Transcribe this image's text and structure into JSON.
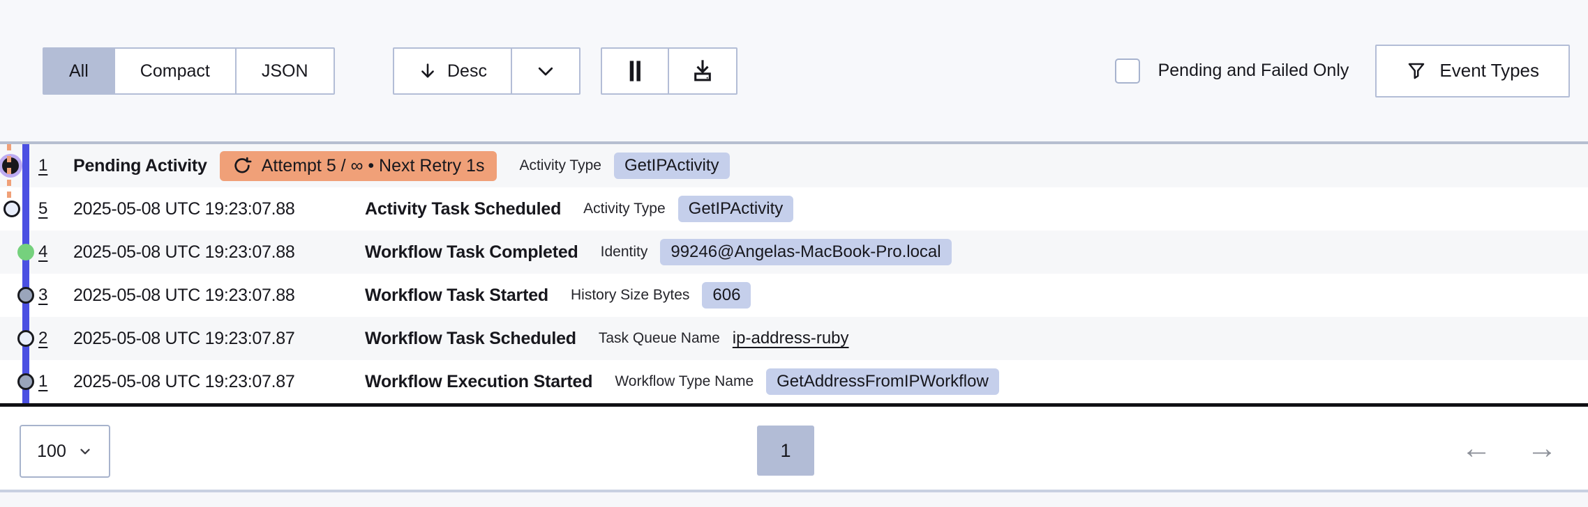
{
  "toolbar": {
    "view_modes": [
      {
        "key": "all",
        "label": "All",
        "selected": true
      },
      {
        "key": "compact",
        "label": "Compact",
        "selected": false
      },
      {
        "key": "json",
        "label": "JSON",
        "selected": false
      }
    ],
    "sort": {
      "label": "Desc"
    },
    "filter_checkbox": {
      "label": "Pending and Failed Only",
      "checked": false
    },
    "event_types_button": {
      "label": "Event Types"
    }
  },
  "icons": {
    "sort": "arrow-down-icon",
    "sort_menu": "chevron-down-icon",
    "pause": "pause-icon",
    "download": "download-icon",
    "event_types": "filter-funnel-icon",
    "retry": "retry-icon",
    "page_size": "chevron-down-icon",
    "prev": "arrow-left-icon",
    "next": "arrow-right-icon"
  },
  "events": [
    {
      "id": "1",
      "timestamp": "",
      "name": "Pending Activity",
      "pending": true,
      "retry_badge": "Attempt 5 / ∞ • Next Retry 1s",
      "detail_label": "Activity Type",
      "detail_value": "GetIPActivity",
      "detail_style": "badge",
      "marker": "pending",
      "row_bg": "shade"
    },
    {
      "id": "5",
      "timestamp": "2025-05-08 UTC 19:23:07.88",
      "name": "Activity Task Scheduled",
      "pending": false,
      "retry_badge": "",
      "detail_label": "Activity Type",
      "detail_value": "GetIPActivity",
      "detail_style": "badge",
      "marker": "offset-light",
      "row_bg": "white"
    },
    {
      "id": "4",
      "timestamp": "2025-05-08 UTC 19:23:07.88",
      "name": "Workflow Task Completed",
      "pending": false,
      "retry_badge": "",
      "detail_label": "Identity",
      "detail_value": "99246@Angelas-MacBook-Pro.local",
      "detail_style": "badge",
      "marker": "completed",
      "row_bg": "shade"
    },
    {
      "id": "3",
      "timestamp": "2025-05-08 UTC 19:23:07.88",
      "name": "Workflow Task Started",
      "pending": false,
      "retry_badge": "",
      "detail_label": "History Size Bytes",
      "detail_value": "606",
      "detail_style": "badge",
      "marker": "started",
      "row_bg": "white"
    },
    {
      "id": "2",
      "timestamp": "2025-05-08 UTC 19:23:07.87",
      "name": "Workflow Task Scheduled",
      "pending": false,
      "retry_badge": "",
      "detail_label": "Task Queue Name",
      "detail_value": "ip-address-ruby",
      "detail_style": "link",
      "marker": "scheduled",
      "row_bg": "shade"
    },
    {
      "id": "1",
      "timestamp": "2025-05-08 UTC 19:23:07.87",
      "name": "Workflow Execution Started",
      "pending": false,
      "retry_badge": "",
      "detail_label": "Workflow Type Name",
      "detail_value": "GetAddressFromIPWorkflow",
      "detail_style": "badge",
      "marker": "started",
      "row_bg": "white"
    }
  ],
  "pagination": {
    "page_size": "100",
    "current_page": "1"
  },
  "colors": {
    "page_bg": "#f7f8fb",
    "selected_segment_bg": "#b3bdd6",
    "button_border": "#b3bdd6",
    "retry_badge_bg": "#f0a078",
    "detail_badge_bg": "#c5cfeb",
    "timeline_blue": "#4b50e2",
    "dashed_orange": "#f0a078",
    "dot_green": "#75d17d",
    "dot_gray": "#9aa5bb",
    "dot_light": "#e9eefb",
    "pending_dot_ring": "#bcabf2",
    "pending_dot_fill": "#18181c",
    "page_button_bg": "#b2bcd6"
  }
}
